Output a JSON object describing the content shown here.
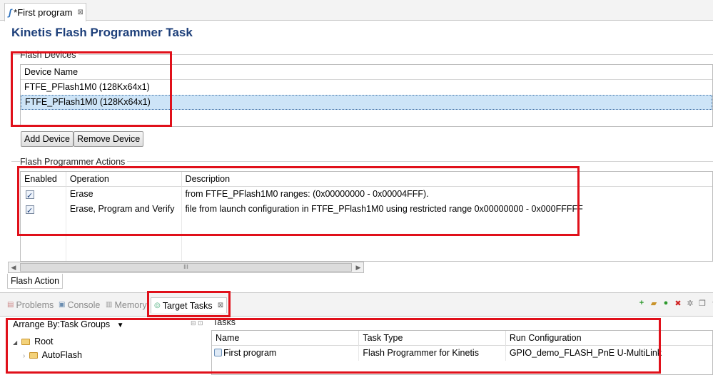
{
  "editor": {
    "tab_title": "*First program",
    "tab_icon": "flash-program-icon",
    "page_title": "Kinetis Flash Programmer Task"
  },
  "flash_devices": {
    "label": "Flash Devices",
    "column": "Device Name",
    "rows": [
      "FTFE_PFlash1M0 (128Kx64x1)",
      "FTFE_PFlash1M0 (128Kx64x1)"
    ],
    "selected_index": 1,
    "add_button": "Add Device",
    "remove_button": "Remove Device"
  },
  "actions": {
    "label": "Flash Programmer Actions",
    "columns": [
      "Enabled",
      "Operation",
      "Description"
    ],
    "rows": [
      {
        "enabled": true,
        "operation": "Erase",
        "description": "from FTFE_PFlash1M0 ranges: (0x00000000 - 0x00004FFF)."
      },
      {
        "enabled": true,
        "operation": "Erase, Program and Verify",
        "description": "file from launch configuration in FTFE_PFlash1M0 using restricted range 0x00000000 - 0x000FFFFF"
      }
    ],
    "scroll_thumb": "III"
  },
  "bottom_tab": "Flash Action",
  "views": {
    "tabs": [
      {
        "label": "Problems",
        "icon": "problems-icon"
      },
      {
        "label": "Console",
        "icon": "console-icon"
      },
      {
        "label": "Memory",
        "icon": "memory-icon"
      },
      {
        "label": "Target Tasks",
        "icon": "target-tasks-icon"
      }
    ],
    "toolbar_icons": [
      "add-icon",
      "open-folder-icon",
      "run-icon",
      "delete-icon",
      "settings-icon",
      "copy-icon",
      "view-menu-icon"
    ]
  },
  "target_tasks": {
    "arrange_label": "Arrange By:Task Groups",
    "tree": {
      "root": "Root",
      "child": "AutoFlash"
    },
    "tasks_label": "Tasks",
    "columns": [
      "Name",
      "Task Type",
      "Run Configuration"
    ],
    "rows": [
      {
        "name": "First program",
        "type": "Flash Programmer for Kinetis",
        "config": "GPIO_demo_FLASH_PnE U-MultiLink"
      }
    ]
  }
}
